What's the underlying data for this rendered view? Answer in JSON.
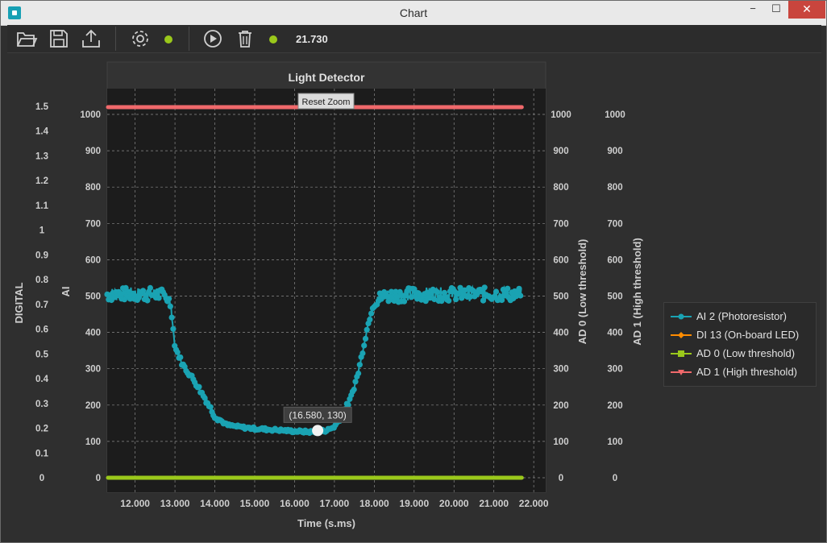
{
  "window": {
    "title": "Chart",
    "minimize": "−",
    "maximize": "☐",
    "close": "✕"
  },
  "toolbar": {
    "icons": [
      "open-folder-icon",
      "save-icon",
      "export-icon",
      "settings-icon",
      "play-icon",
      "trash-icon"
    ],
    "connection_status_color": "#9ac81b",
    "running_status_color": "#9ac81b",
    "time_readout": "21.730"
  },
  "chart_data": {
    "type": "line",
    "title": "Light Detector",
    "xlabel": "Time (s.ms)",
    "xlim": [
      11.3,
      22.3
    ],
    "x_ticks": [
      "12.000",
      "13.000",
      "14.000",
      "15.000",
      "16.000",
      "17.000",
      "18.000",
      "19.000",
      "20.000",
      "21.000",
      "22.000"
    ],
    "y_axes": [
      {
        "label": "DIGITAL",
        "side": "left-outer",
        "range": [
          0,
          1.5
        ],
        "ticks": [
          "1.5",
          "1.4",
          "1.3",
          "1.2",
          "1.1",
          "1",
          "0.9",
          "0.8",
          "0.7",
          "0.6",
          "0.5",
          "0.4",
          "0.3",
          "0.2",
          "0.1",
          "0"
        ]
      },
      {
        "label": "AI",
        "side": "left-inner",
        "range": [
          0,
          1000
        ],
        "ticks": [
          "1000",
          "900",
          "800",
          "700",
          "600",
          "500",
          "400",
          "300",
          "200",
          "100",
          "0"
        ]
      },
      {
        "label": "AD 0 (Low threshold)",
        "side": "right-inner",
        "range": [
          0,
          1000
        ],
        "ticks": [
          "1000",
          "900",
          "800",
          "700",
          "600",
          "500",
          "400",
          "300",
          "200",
          "100",
          "0"
        ]
      },
      {
        "label": "AD 1 (High threshold)",
        "side": "right-outer",
        "range": [
          0,
          1000
        ],
        "ticks": [
          "1000",
          "900",
          "800",
          "700",
          "600",
          "500",
          "400",
          "300",
          "200",
          "100",
          "0"
        ]
      }
    ],
    "grid": true,
    "legend_position": "right",
    "series": [
      {
        "name": "AI 2 (Photoresistor)",
        "color": "#1aa3b3",
        "marker": "circle",
        "x": [
          11.3,
          12.0,
          12.5,
          12.8,
          12.9,
          13.0,
          13.2,
          13.5,
          13.8,
          14.0,
          14.3,
          14.6,
          15.0,
          15.5,
          16.0,
          16.4,
          16.8,
          17.0,
          17.2,
          17.4,
          17.6,
          17.8,
          17.95,
          18.2,
          19.0,
          20.0,
          21.0,
          21.7
        ],
        "values": [
          505,
          505,
          505,
          500,
          470,
          360,
          310,
          265,
          210,
          170,
          145,
          140,
          135,
          132,
          128,
          126,
          130,
          140,
          175,
          215,
          290,
          400,
          470,
          500,
          505,
          505,
          505,
          505
        ]
      },
      {
        "name": "DI 13 (On-board LED)",
        "color": "#ff8c00",
        "marker": "diamond",
        "x": [],
        "values": []
      },
      {
        "name": "AD 0 (Low threshold)",
        "color": "#9ac81b",
        "marker": "square",
        "x": [
          11.3,
          21.7
        ],
        "values": [
          0,
          0
        ]
      },
      {
        "name": "AD 1 (High threshold)",
        "color": "#f0696b",
        "marker": "triangle",
        "x": [
          11.3,
          21.7
        ],
        "values": [
          1020,
          1020
        ]
      }
    ],
    "annotations": [
      {
        "text": "(16.580, 130)",
        "x": 16.58,
        "y": 130
      }
    ]
  },
  "chart_controls": {
    "reset_zoom": "Reset Zoom"
  }
}
